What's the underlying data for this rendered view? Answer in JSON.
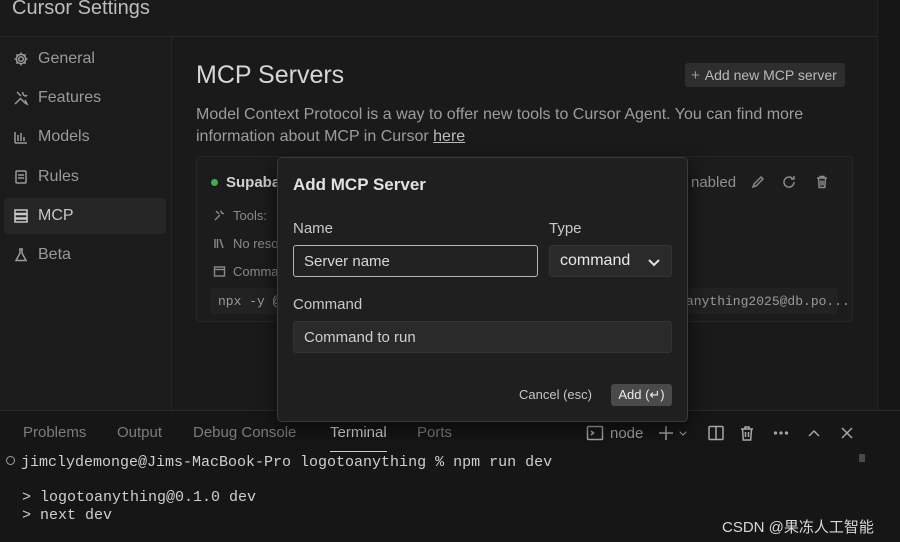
{
  "app": {
    "title": "Cursor Settings"
  },
  "sidebar": {
    "items": [
      {
        "label": "General",
        "icon": "gear-icon"
      },
      {
        "label": "Features",
        "icon": "tools-icon"
      },
      {
        "label": "Models",
        "icon": "chart-icon"
      },
      {
        "label": "Rules",
        "icon": "document-icon"
      },
      {
        "label": "MCP",
        "icon": "server-icon",
        "active": true
      },
      {
        "label": "Beta",
        "icon": "flask-icon"
      }
    ]
  },
  "main": {
    "title": "MCP Servers",
    "add_button": "Add new MCP server",
    "description": "Model Context Protocol is a way to offer new tools to Cursor Agent. You can find more information about MCP in Cursor",
    "description_link": "here",
    "server": {
      "name": "Supaba",
      "status_color": "#4ca65a",
      "enabled_text": "nabled",
      "tools_label": "Tools:",
      "resources_label": "No reso",
      "command_label": "Comma",
      "command_left": "npx -y @n",
      "command_right": "anything2025@db.po..."
    }
  },
  "dialog": {
    "title": "Add MCP Server",
    "name_label": "Name",
    "name_placeholder": "Server name",
    "type_label": "Type",
    "type_value": "command",
    "command_label": "Command",
    "command_placeholder": "Command to run",
    "cancel_label": "Cancel (esc)",
    "add_label": "Add (↵)"
  },
  "panel": {
    "tabs": [
      "Problems",
      "Output",
      "Debug Console",
      "Terminal",
      "Ports"
    ],
    "active_tab": "Terminal",
    "shell_label": "node",
    "terminal_lines": [
      "jimclydemonge@Jims-MacBook-Pro logotoanything % npm run dev",
      "> logotoanything@0.1.0 dev",
      "> next dev"
    ]
  },
  "watermark": "CSDN @果冻人工智能"
}
